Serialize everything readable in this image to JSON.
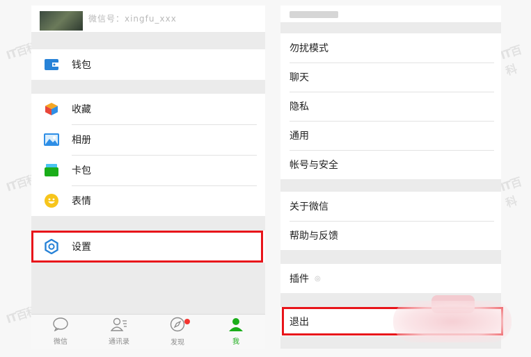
{
  "left_panel": {
    "profile_id": "微信号：xingfu_xxx",
    "groups": [
      {
        "items": [
          {
            "label": "钱包",
            "icon": "wallet-icon",
            "color": "#2782d7"
          }
        ]
      },
      {
        "items": [
          {
            "label": "收藏",
            "icon": "favorites-cube-icon",
            "color": "#f5a623"
          },
          {
            "label": "相册",
            "icon": "album-photo-icon",
            "color": "#2e8ee6"
          },
          {
            "label": "卡包",
            "icon": "card-bag-icon",
            "color": "#1aad19"
          },
          {
            "label": "表情",
            "icon": "smiley-icon",
            "color": "#f7c51c"
          }
        ]
      },
      {
        "items": [
          {
            "label": "设置",
            "icon": "settings-gear-icon",
            "color": "#2782d7"
          }
        ]
      }
    ],
    "tabs": [
      {
        "label": "微信",
        "icon": "chat-bubble-icon"
      },
      {
        "label": "通讯录",
        "icon": "contacts-icon"
      },
      {
        "label": "发现",
        "icon": "compass-icon"
      },
      {
        "label": "我",
        "icon": "person-icon",
        "active": true
      }
    ]
  },
  "right_panel": {
    "group1": [
      "勿扰模式",
      "聊天",
      "隐私",
      "通用",
      "帐号与安全"
    ],
    "group2": [
      "关于微信",
      "帮助与反馈"
    ],
    "group3": {
      "label": "插件",
      "sub": "◎"
    },
    "group4": [
      "退出"
    ]
  },
  "watermark": "IT百科",
  "colors": {
    "highlight": "#e8141a",
    "active_tab": "#1aad19",
    "badge": "#f43530"
  }
}
